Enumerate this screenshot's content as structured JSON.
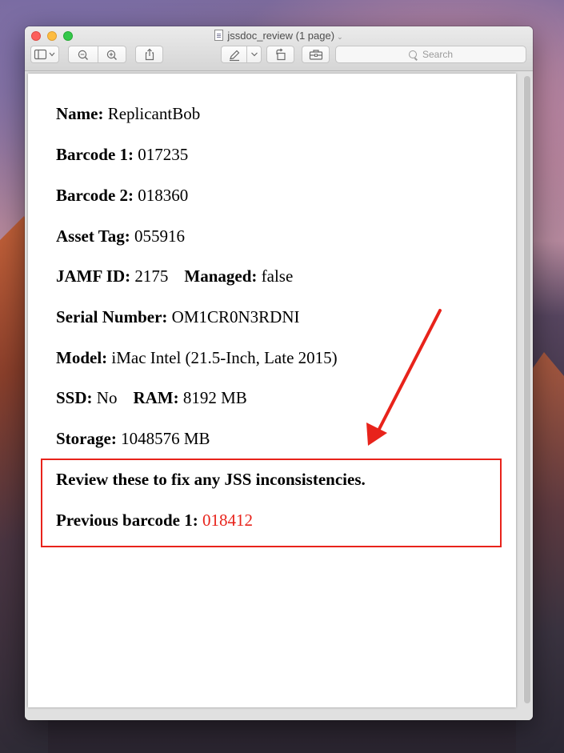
{
  "window": {
    "title": "jssdoc_review (1 page)"
  },
  "toolbar": {
    "search_placeholder": "Search"
  },
  "document": {
    "name_label": "Name:",
    "name_value": "ReplicantBob",
    "barcode1_label": "Barcode 1:",
    "barcode1_value": "017235",
    "barcode2_label": "Barcode 2:",
    "barcode2_value": "018360",
    "asset_tag_label": "Asset Tag:",
    "asset_tag_value": "055916",
    "jamf_id_label": "JAMF ID:",
    "jamf_id_value": "2175",
    "managed_label": "Managed:",
    "managed_value": "false",
    "serial_label": "Serial Number:",
    "serial_value": "OM1CR0N3RDNI",
    "model_label": "Model:",
    "model_value": "iMac Intel (21.5-Inch, Late 2015)",
    "ssd_label": "SSD:",
    "ssd_value": "No",
    "ram_label": "RAM:",
    "ram_value": "8192 MB",
    "storage_label": "Storage:",
    "storage_value": "1048576 MB",
    "review_heading": "Review these to fix any JSS inconsistencies.",
    "previous_barcode_label": "Previous barcode 1:",
    "previous_barcode_value": "018412"
  },
  "colors": {
    "annotation_red": "#e8231b"
  },
  "icons": {
    "sidebar_toggle": "sidebar-icon",
    "zoom_out": "zoom-out-icon",
    "zoom_in": "zoom-in-icon",
    "share": "share-icon",
    "markup": "pen-icon",
    "rotate": "rotate-icon",
    "toolbox": "toolbox-icon",
    "search": "search-icon"
  }
}
